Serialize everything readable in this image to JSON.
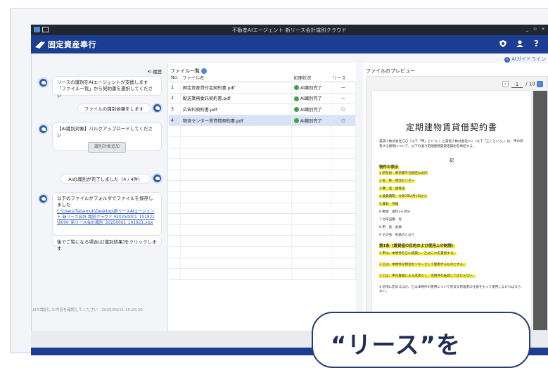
{
  "window": {
    "title": "不動産AIエージェント 新リース会計識別クラウド",
    "controls": {
      "minimize": "_",
      "maximize": "▫",
      "close": "×"
    }
  },
  "header": {
    "logo_text": "固定資産奉行",
    "icons": [
      "help-badge-icon",
      "user-icon",
      "question-icon"
    ],
    "question_label": "?"
  },
  "guide_link": "AIガイドライン",
  "chat": {
    "history_label": "履歴",
    "messages": [
      {
        "from": "ai",
        "text": "リースの識別をAIエージェントが支援します\n「ファイル一覧」から契約書を選択してください"
      },
      {
        "from": "user",
        "text": "ファイルの識別依頼をします"
      },
      {
        "from": "ai",
        "text": "【AI識別対象】バルクアップロードしてください",
        "button": "識別対象追加"
      },
      {
        "from": "user",
        "text": "AIの識別が完了しました（4 / 4件）"
      },
      {
        "from": "ai",
        "text": "以下のファイルがフォルダでファイルを保存しました\n",
        "link": "C:\\Users\\Taisamuk\\Desktop\\新リースAIエージェント 新リース会計 識別クラウド ¥20250001_101921\\8000_新リース会計識別_20250001_101921.xlsx",
        "footer": "後でご覧になる場合は[識別結果]をクリックします"
      }
    ],
    "timestamp": "AIが識別した内容を確認してください　2025/09/11 15:20:30"
  },
  "file_list": {
    "title": "ファイル一覧",
    "columns": [
      "No.",
      "ファイル名",
      "処理状況",
      "リース"
    ],
    "rows": [
      {
        "no": "1",
        "name": "固定資産貸付金契約書.pdf",
        "status": "AI識別完了",
        "lease": "—"
      },
      {
        "no": "2",
        "name": "配送業務委託契約書.pdf",
        "status": "AI識別完了",
        "lease": "—"
      },
      {
        "no": "3",
        "name": "広告料契約書.pdf",
        "status": "AI識別完了",
        "lease": "○"
      },
      {
        "no": "4",
        "name": "物流センター賃貸借契約書.pdf",
        "status": "AI識別完了",
        "lease": "○"
      }
    ],
    "selected_index": 3,
    "empty_rows": 14
  },
  "preview": {
    "title": "ファイルのプレビュー",
    "page_current": "1",
    "page_total": "/ 10",
    "doc_title": "定期建物賃貸借契約書",
    "intro": "賃貸人株式会社〇〇（以下「甲」という。）と賃借人株式会社××（以下「乙」という。）は、甲の所有する建物について、以下の通り定期建物賃貸借契約を締結する。",
    "section_heading": "物件の表示",
    "items": [
      "1 所在地　東京都千代田区丸の内",
      "2 名　称　物流センター",
      "3 構　造　鉄骨造",
      "4 賃貸期間　令和7年4月1日から",
      "5 賃料　月額",
      "6 敷金　賃料3ヶ月分",
      "7 付帯設備　有",
      "8 用　途　倉庫",
      "9 その他　別紙のとおり"
    ],
    "article1": "第1条（賃貸借の目的および使用上の制限）",
    "article_items": [
      "1 甲は、本物件を乙に賃貸し、乙はこれを賃借する。",
      "2 乙は、本物件を物流センターとして使用するものとする。",
      "3 乙は、甲の書面による承諾なく、本物件を転貸してはならない。",
      "4 前項に定めるほか、乙は本物件の使用について善良な管理者の注意をもって使用しなければならない。"
    ]
  },
  "callout": "“リース”を"
}
